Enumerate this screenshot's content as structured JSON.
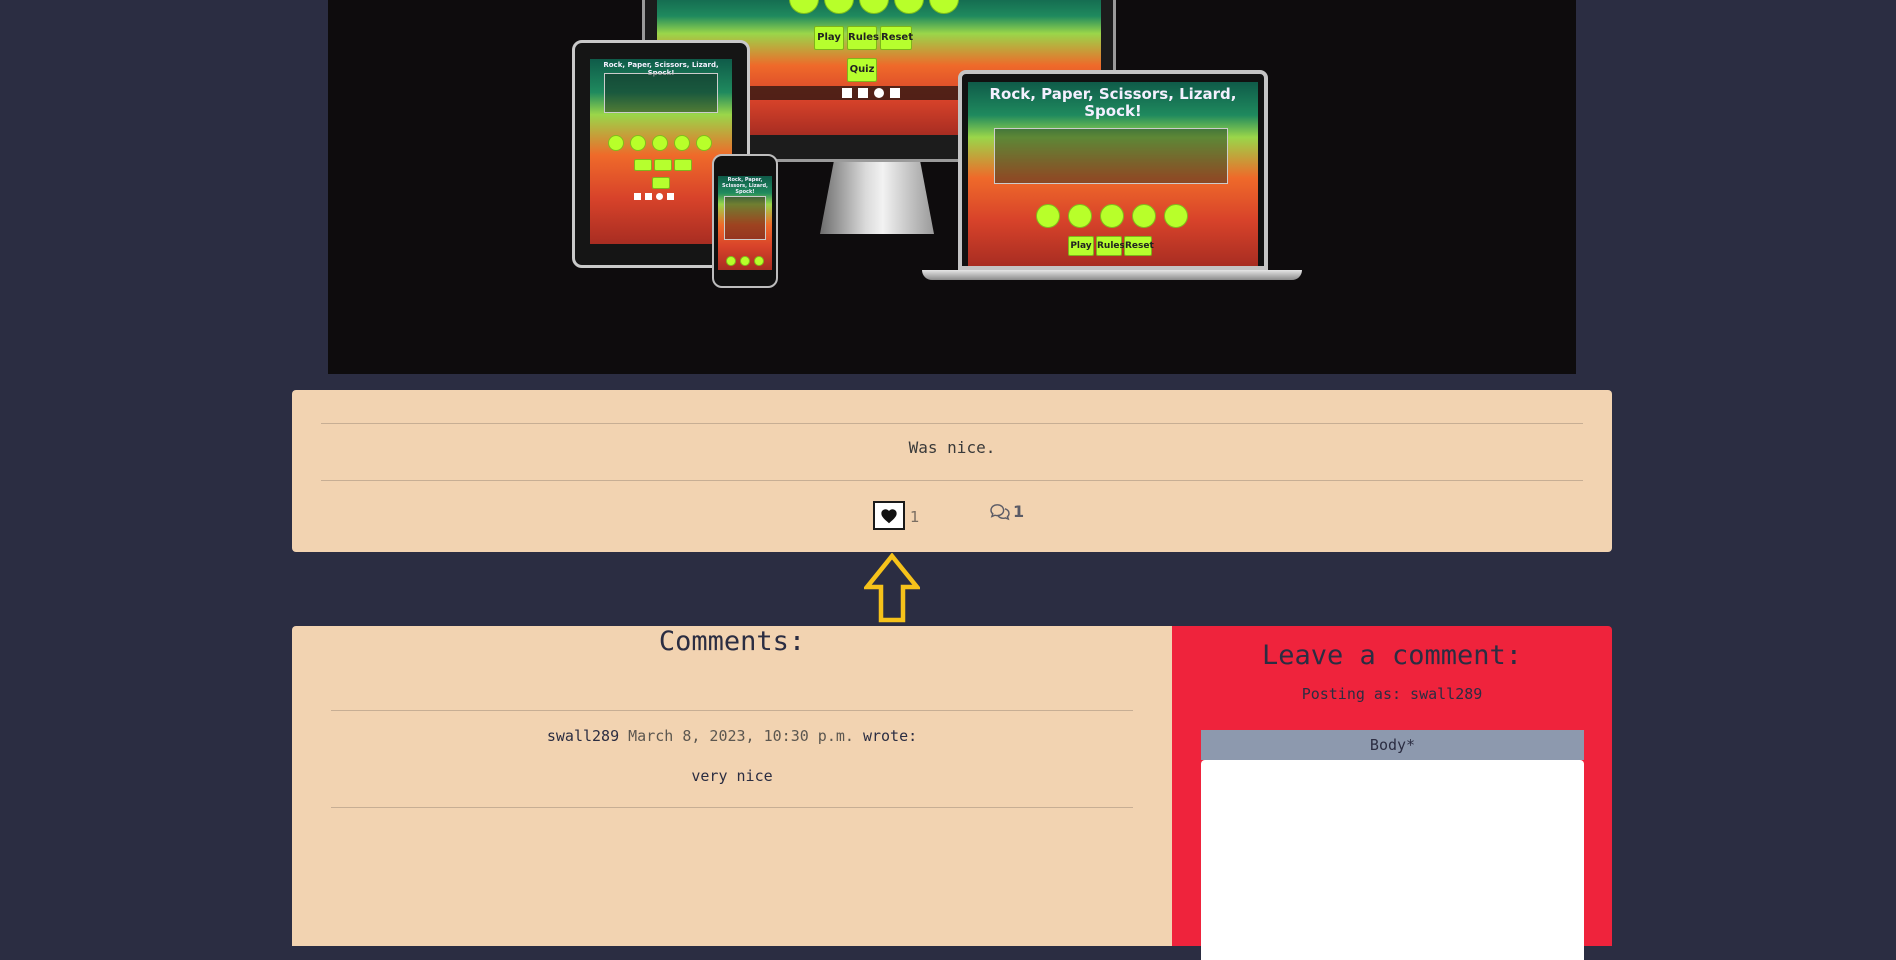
{
  "hero": {
    "game_title": "Rock, Paper, Scissors, Lizard, Spock!",
    "game_title_line1": "Rock, Paper, Scissors, Lizard,",
    "game_title_line2": "Spock!",
    "buttons": {
      "play": "Play",
      "rules": "Rules",
      "reset": "Reset",
      "quiz": "Quiz"
    }
  },
  "post": {
    "text": "Was nice.",
    "likes": "1",
    "comments": "1"
  },
  "comments_section": {
    "heading": "Comments:",
    "items": [
      {
        "author": "swall289",
        "date": "March 8, 2023, 10:30 p.m.",
        "wrote": "wrote:",
        "body": "very nice"
      }
    ]
  },
  "comment_form": {
    "heading": "Leave a comment:",
    "posting_as": "Posting as: swall289",
    "body_label": "Body*",
    "body_value": ""
  },
  "colors": {
    "page_bg": "#2b2d42",
    "card_bg": "#f2d3b1",
    "form_bg": "#ef233c",
    "label_bg": "#8d99ae",
    "annotation": "#f6c21a",
    "game_button": "#b6ff2e"
  }
}
